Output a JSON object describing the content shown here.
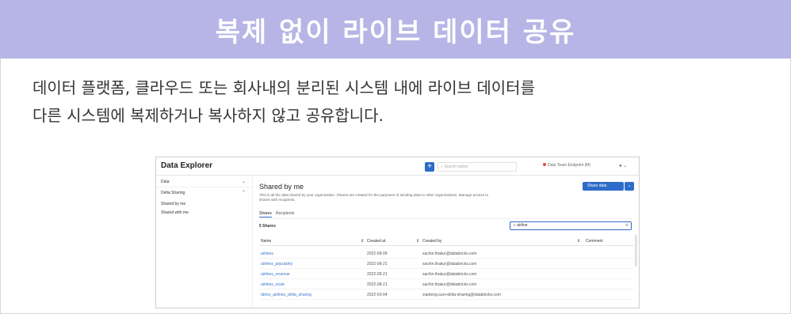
{
  "banner": {
    "title": "복제 없이 라이브 데이터 공유"
  },
  "description": {
    "line1": "데이터 플랫폼, 클라우드 또는 회사내의 분리된 시스템 내에 라이브 데이터를",
    "line2": "다른 시스템에 복제하거나 복사하지 않고 공유합니다."
  },
  "colors": {
    "banner": "#b7b5e6",
    "accent": "#2d6cc8",
    "link": "#3a74c9"
  },
  "app": {
    "title": "Data Explorer",
    "add_label": "+",
    "search_placeholder": "Search tables",
    "endpoint": "Data Team Endpoint (M)",
    "user_icon": "user-icon",
    "sidebar": {
      "data": "Data",
      "delta_sharing": "Delta Sharing",
      "shared_by_me": "Shared by me",
      "shared_with_me": "Shared with me"
    },
    "main": {
      "heading": "Shared by me",
      "intro": "This is all the data shared by your organization. Shares are created for the purposes of sending data to other organizations. Manage access to shares with recipients.",
      "share_button": "Share data",
      "tabs": [
        "Shares",
        "Recipients"
      ],
      "count": "5 Shares",
      "filter_value": "airline",
      "columns": [
        "Name",
        "Created at",
        "Created by",
        "Comment"
      ],
      "rows": [
        {
          "name": "airlines",
          "created_at": "2022-08-09",
          "created_by": "sachin.thakur@databricks.com"
        },
        {
          "name": "airlines_popularity",
          "created_at": "2022-08-21",
          "created_by": "sachin.thakur@databricks.com"
        },
        {
          "name": "airlines_revenue",
          "created_at": "2022-08-21",
          "created_by": "sachin.thakur@databricks.com"
        },
        {
          "name": "airlines_route",
          "created_at": "2022-08-21",
          "created_by": "sachin.thakur@databricks.com"
        },
        {
          "name": "demo_airlines_delta_sharing",
          "created_at": "2022-03-04",
          "created_by": "xiaoteng.sun+delta-sharing@databricks.com"
        }
      ]
    }
  }
}
